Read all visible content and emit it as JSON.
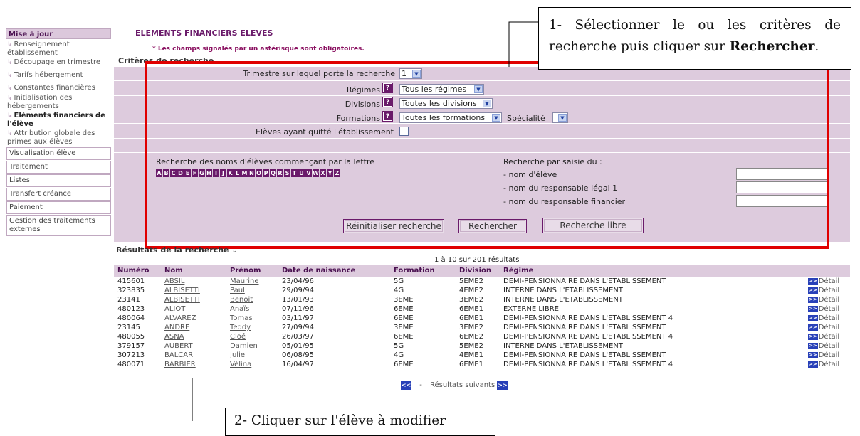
{
  "sidebar": {
    "header": "Mise à jour",
    "sub_items": [
      {
        "label": "Renseignement établissement",
        "active": false
      },
      {
        "label": "Découpage en trimestre",
        "active": false
      },
      {
        "label": "Tarifs hébergement",
        "active": false
      },
      {
        "label": "Constantes financières",
        "active": false
      },
      {
        "label": "Initialisation des hébergements",
        "active": false
      },
      {
        "label": "Eléments financiers de l'élève",
        "active": true
      },
      {
        "label": "Attribution globale des primes aux élèves",
        "active": false
      }
    ],
    "boxes": [
      "Visualisation élève",
      "Traitement",
      "Listes",
      "Transfert créance",
      "Paiement",
      "Gestion des traitements externes"
    ]
  },
  "page": {
    "title": "ELEMENTS FINANCIERS ELEVES",
    "mandatory_note": "* Les champs signalés par un astérisque sont obligatoires."
  },
  "criteria": {
    "section_title": "Critères de recherche",
    "trimestre_label": "Trimestre sur lequel porte la recherche",
    "trimestre_value": "1",
    "regimes_label": "Régimes",
    "regimes_value": "Tous les régimes",
    "divisions_label": "Divisions",
    "divisions_value": "Toutes les divisions",
    "formations_label": "Formations",
    "formations_value": "Toutes les formations",
    "specialite_label": "Spécialité",
    "specialite_value": "",
    "quit_label": "Elèves ayant quitté l'établissement",
    "quit_checked": false,
    "letters_label": "Recherche des noms d'élèves commençant par la lettre",
    "letters": [
      "A",
      "B",
      "C",
      "D",
      "E",
      "F",
      "G",
      "H",
      "I",
      "J",
      "K",
      "L",
      "M",
      "N",
      "O",
      "P",
      "Q",
      "R",
      "S",
      "T",
      "U",
      "V",
      "W",
      "X",
      "Y",
      "Z"
    ],
    "saisie_label": "Recherche par saisie du :",
    "field_eleve": "- nom d'élève",
    "field_resp1": "- nom du responsable légal 1",
    "field_respfin": "- nom du responsable financier",
    "btn_reset": "Réinitialiser recherche",
    "btn_search": "Rechercher",
    "btn_free": "Recherche libre"
  },
  "results": {
    "section_title": "Résultats de la recherche",
    "count": "1 à 10 sur 201 résultats",
    "columns": [
      "Numéro",
      "Nom",
      "Prénom",
      "Date de naissance",
      "Formation",
      "Division",
      "Régime"
    ],
    "detail_label": "Détail",
    "rows": [
      {
        "num": "415601",
        "nom": "ABSIL",
        "prenom": "Maurine",
        "date": "23/04/96",
        "formation": "5G",
        "division": "5EME2",
        "regime": "DEMI-PENSIONNAIRE DANS L'ETABLISSEMENT"
      },
      {
        "num": "323835",
        "nom": "ALBISETTI",
        "prenom": "Paul",
        "date": "29/09/94",
        "formation": "4G",
        "division": "4EME2",
        "regime": "INTERNE DANS L'ETABLISSEMENT"
      },
      {
        "num": "23141",
        "nom": "ALBISETTI",
        "prenom": "Benoit",
        "date": "13/01/93",
        "formation": "3EME",
        "division": "3EME2",
        "regime": "INTERNE DANS L'ETABLISSEMENT"
      },
      {
        "num": "480123",
        "nom": "ALIOT",
        "prenom": "Anaïs",
        "date": "07/11/96",
        "formation": "6EME",
        "division": "6EME1",
        "regime": "EXTERNE LIBRE"
      },
      {
        "num": "480064",
        "nom": "ALVAREZ",
        "prenom": "Tomas",
        "date": "03/11/97",
        "formation": "6EME",
        "division": "6EME1",
        "regime": "DEMI-PENSIONNAIRE DANS L'ETABLISSEMENT 4"
      },
      {
        "num": "23145",
        "nom": "ANDRE",
        "prenom": "Teddy",
        "date": "27/09/94",
        "formation": "3EME",
        "division": "3EME2",
        "regime": "DEMI-PENSIONNAIRE DANS L'ETABLISSEMENT"
      },
      {
        "num": "480055",
        "nom": "ASNA",
        "prenom": "Cloé",
        "date": "26/03/97",
        "formation": "6EME",
        "division": "6EME2",
        "regime": "DEMI-PENSIONNAIRE DANS L'ETABLISSEMENT 4"
      },
      {
        "num": "379157",
        "nom": "AUBERT",
        "prenom": "Damien",
        "date": "05/01/95",
        "formation": "5G",
        "division": "5EME2",
        "regime": "INTERNE DANS L'ETABLISSEMENT"
      },
      {
        "num": "307213",
        "nom": "BALCAR",
        "prenom": "Julie",
        "date": "06/08/95",
        "formation": "4G",
        "division": "4EME1",
        "regime": "DEMI-PENSIONNAIRE DANS L'ETABLISSEMENT"
      },
      {
        "num": "480071",
        "nom": "BARBIER",
        "prenom": "Vélina",
        "date": "16/04/97",
        "formation": "6EME",
        "division": "6EME1",
        "regime": "DEMI-PENSIONNAIRE DANS L'ETABLISSEMENT 4"
      }
    ],
    "pagination_dash": "-",
    "next_label": "Résultats suivants"
  },
  "callouts": {
    "top_prefix": "1- Sélectionner le ou les critères de recherche puis cliquer sur ",
    "top_bold": "Rechercher",
    "top_suffix": ".",
    "bottom_partial": "2- Cliquer sur l'élève à modifier"
  },
  "colors": {
    "accent": "#6a1a6a",
    "panel": "#ddcbdd",
    "frame": "#e00000",
    "icon_blue": "#2840b8"
  }
}
